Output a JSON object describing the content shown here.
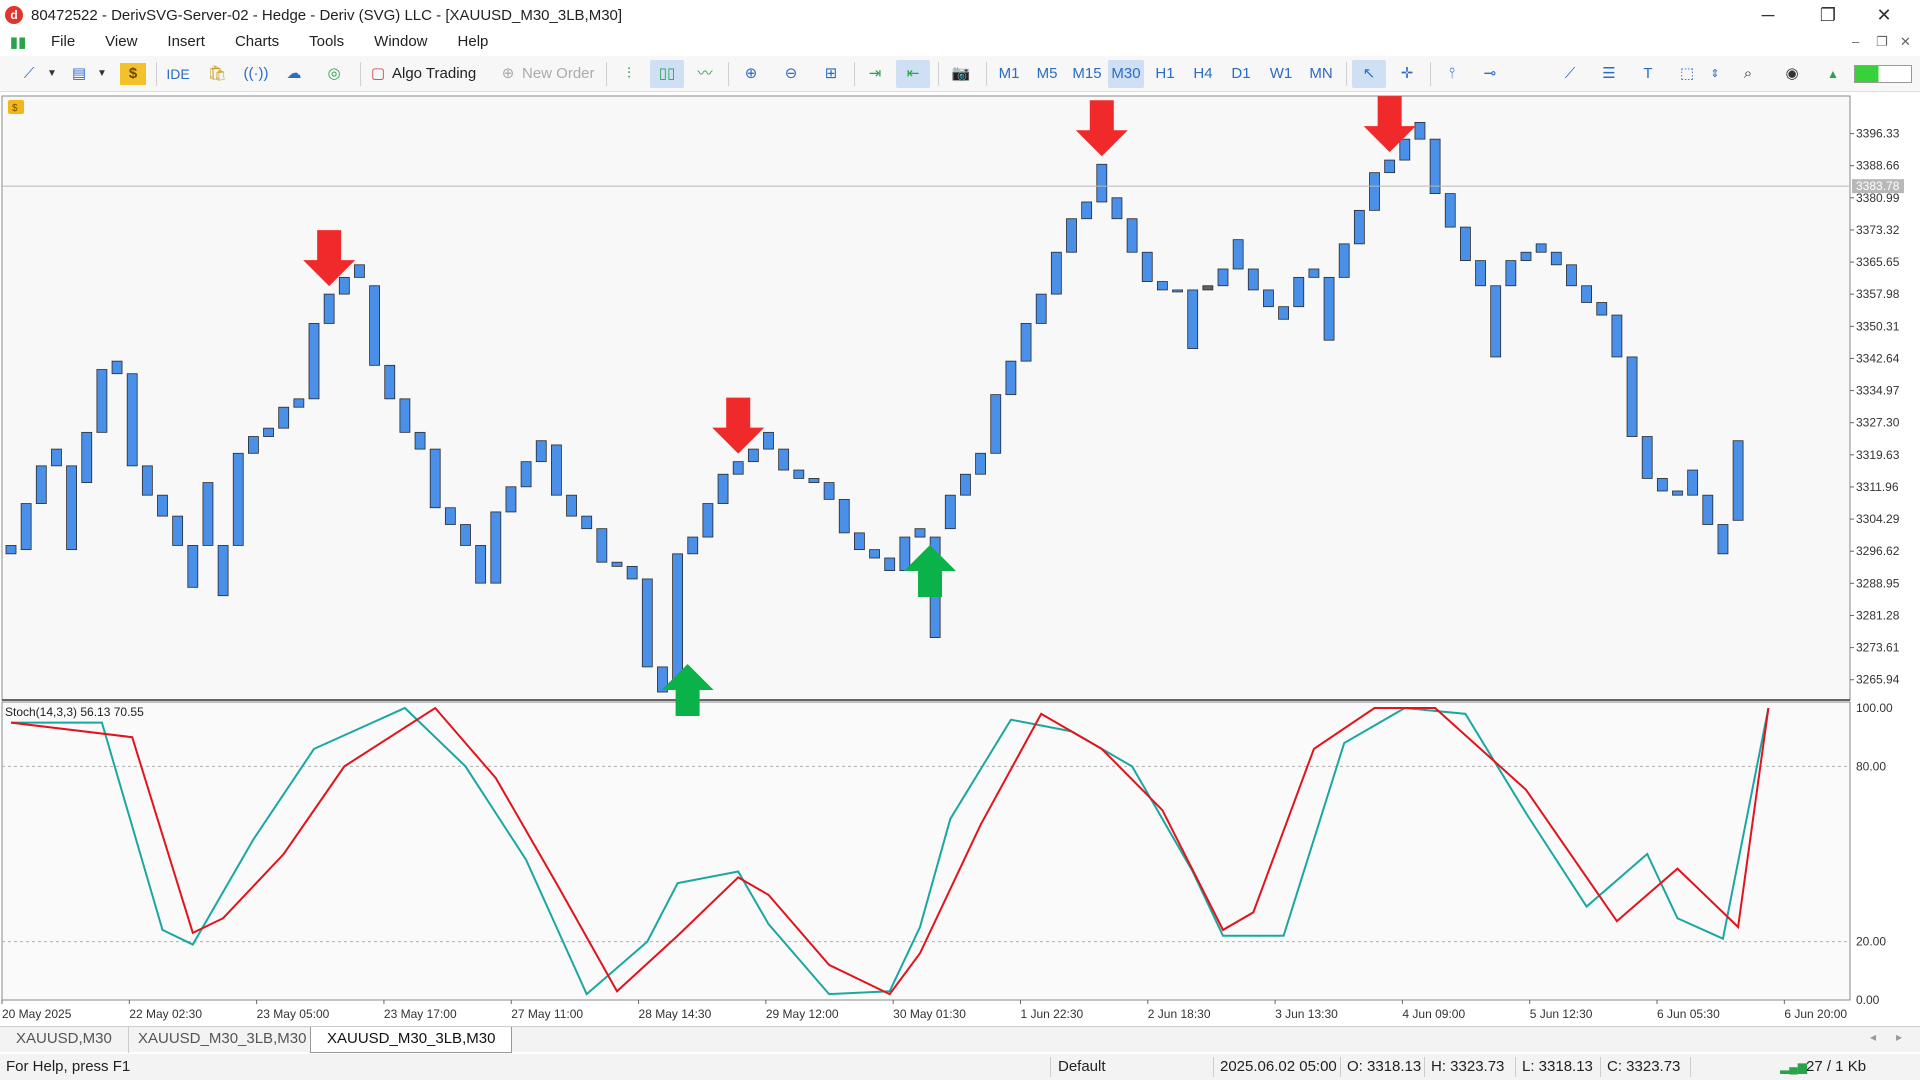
{
  "window": {
    "title": "80472522 - DerivSVG-Server-02 - Hedge - Deriv (SVG) LLC - [XAUUSD_M30_3LB,M30]",
    "minimize": "─",
    "maximize": "❐",
    "close": "✕"
  },
  "menu": {
    "items": [
      "File",
      "View",
      "Insert",
      "Charts",
      "Tools",
      "Window",
      "Help"
    ],
    "mdi": [
      "–",
      "❐",
      "✕"
    ]
  },
  "toolbar": {
    "ide_label": "IDE",
    "algo_label": "Algo Trading",
    "new_order_label": "New Order",
    "timeframes": [
      "M1",
      "M5",
      "M15",
      "M30",
      "H1",
      "H4",
      "D1",
      "W1",
      "MN"
    ],
    "active_timeframe": "M30",
    "accent": "#2b6cc4"
  },
  "chart": {
    "symbol": "XAUUSD_M30_3LB",
    "bull_color": "#4a8fe8",
    "bear_color": "#5f6167",
    "bid_price_label": "3383.78",
    "indicator_label": "Stoch(14,3,3) 56.13 70.55",
    "main_color": "#1aa7a1",
    "signal_color": "#e2131b"
  },
  "chart_data": [
    {
      "type": "candlestick",
      "description": "Line break price chart, XAUUSD M30",
      "y_ticks": [
        "3396.33",
        "3388.66",
        "3380.99",
        "3373.32",
        "3365.65",
        "3357.98",
        "3350.31",
        "3342.64",
        "3334.97",
        "3327.30",
        "3319.63",
        "3311.96",
        "3304.29",
        "3296.62",
        "3288.95",
        "3281.28",
        "3273.61",
        "3265.94"
      ],
      "ylim": [
        3261.1,
        3405.3
      ],
      "x_ticks": [
        "20 May 2025",
        "22 May 02:30",
        "23 May 05:00",
        "23 May 17:00",
        "27 May 11:00",
        "28 May 14:30",
        "29 May 12:00",
        "30 May 01:30",
        "1 Jun 22:30",
        "2 Jun 18:30",
        "3 Jun 13:30",
        "4 Jun 09:00",
        "5 Jun 12:30",
        "6 Jun 05:30",
        "6 Jun 20:00"
      ],
      "bricks": [
        [
          3298,
          3296
        ],
        [
          3308,
          3297
        ],
        [
          3317,
          3308
        ],
        [
          3321,
          3317
        ],
        [
          3317,
          3297
        ],
        [
          3325,
          3313
        ],
        [
          3340,
          3325
        ],
        [
          3342,
          3339
        ],
        [
          3339,
          3317
        ],
        [
          3317,
          3310
        ],
        [
          3310,
          3305
        ],
        [
          3305,
          3298
        ],
        [
          3298,
          3288
        ],
        [
          3313,
          3298
        ],
        [
          3298,
          3286
        ],
        [
          3320,
          3298
        ],
        [
          3324,
          3320
        ],
        [
          3326,
          3324
        ],
        [
          3331,
          3326
        ],
        [
          3333,
          3331
        ],
        [
          3351,
          3333
        ],
        [
          3358,
          3351
        ],
        [
          3362,
          3358
        ],
        [
          3365,
          3362
        ],
        [
          3360,
          3341
        ],
        [
          3341,
          3333
        ],
        [
          3333,
          3325
        ],
        [
          3325,
          3321
        ],
        [
          3321,
          3307
        ],
        [
          3307,
          3303
        ],
        [
          3303,
          3298
        ],
        [
          3298,
          3289
        ],
        [
          3306,
          3289
        ],
        [
          3312,
          3306
        ],
        [
          3318,
          3312
        ],
        [
          3323,
          3318
        ],
        [
          3322,
          3310
        ],
        [
          3310,
          3305
        ],
        [
          3305,
          3302
        ],
        [
          3302,
          3294
        ],
        [
          3294,
          3293
        ],
        [
          3293,
          3290
        ],
        [
          3290,
          3269
        ],
        [
          3269,
          3263
        ],
        [
          3296,
          3265
        ],
        [
          3300,
          3296
        ],
        [
          3308,
          3300
        ],
        [
          3315,
          3308
        ],
        [
          3318,
          3315
        ],
        [
          3321,
          3318
        ],
        [
          3325,
          3321
        ],
        [
          3321,
          3316
        ],
        [
          3316,
          3314
        ],
        [
          3314,
          3313
        ],
        [
          3313,
          3309
        ],
        [
          3309,
          3301
        ],
        [
          3301,
          3297
        ],
        [
          3297,
          3295
        ],
        [
          3295,
          3292
        ],
        [
          3300,
          3292
        ],
        [
          3302,
          3300
        ],
        [
          3300,
          3276
        ],
        [
          3310,
          3302
        ],
        [
          3315,
          3310
        ],
        [
          3320,
          3315
        ],
        [
          3334,
          3320
        ],
        [
          3342,
          3334
        ],
        [
          3351,
          3342
        ],
        [
          3358,
          3351
        ],
        [
          3368,
          3358
        ],
        [
          3376,
          3368
        ],
        [
          3380,
          3376
        ],
        [
          3389,
          3380
        ],
        [
          3381,
          3376
        ],
        [
          3376,
          3368
        ],
        [
          3368,
          3361
        ],
        [
          3361,
          3359
        ],
        [
          3359,
          3359
        ],
        [
          3359,
          3345
        ],
        [
          3359,
          3360
        ],
        [
          3364,
          3360
        ],
        [
          3371,
          3364
        ],
        [
          3364,
          3359
        ],
        [
          3359,
          3355
        ],
        [
          3355,
          3352
        ],
        [
          3362,
          3355
        ],
        [
          3364,
          3362
        ],
        [
          3362,
          3347
        ],
        [
          3370,
          3362
        ],
        [
          3378,
          3370
        ],
        [
          3387,
          3378
        ],
        [
          3390,
          3387
        ],
        [
          3395,
          3390
        ],
        [
          3399,
          3395
        ],
        [
          3395,
          3382
        ],
        [
          3382,
          3374
        ],
        [
          3374,
          3366
        ],
        [
          3366,
          3360
        ],
        [
          3360,
          3343
        ],
        [
          3366,
          3360
        ],
        [
          3368,
          3366
        ],
        [
          3370,
          3368
        ],
        [
          3368,
          3365
        ],
        [
          3365,
          3360
        ],
        [
          3360,
          3356
        ],
        [
          3356,
          3353
        ],
        [
          3353,
          3343
        ],
        [
          3343,
          3324
        ],
        [
          3324,
          3314
        ],
        [
          3314,
          3311
        ],
        [
          3311,
          3310
        ],
        [
          3316,
          3310
        ],
        [
          3310,
          3303
        ],
        [
          3303,
          3296
        ],
        [
          3323,
          3304
        ]
      ],
      "sell_arrows_at_brick": [
        21,
        48,
        72,
        91
      ],
      "buy_arrows_at_brick": [
        44,
        60
      ]
    },
    {
      "type": "line",
      "description": "Stochastic oscillator",
      "ylim": [
        0,
        100
      ],
      "y_ticks": [
        "100.00",
        "80.00",
        "20.00",
        "0.00"
      ],
      "levels": [
        80,
        20
      ],
      "series": [
        {
          "name": "Main",
          "x": [
            0,
            6,
            10,
            12,
            16,
            20,
            26,
            30,
            34,
            38,
            42,
            44,
            48,
            50,
            54,
            58,
            60,
            62,
            66,
            70,
            74,
            78,
            80,
            84,
            88,
            92,
            96,
            100,
            104,
            108,
            110,
            113,
            116
          ],
          "values": [
            95,
            95,
            24,
            19,
            55,
            86,
            100,
            80,
            48,
            2,
            20,
            40,
            44,
            26,
            2,
            3,
            25,
            62,
            96,
            92,
            80,
            44,
            22,
            22,
            88,
            100,
            98,
            64,
            32,
            50,
            28,
            21,
            100
          ]
        },
        {
          "name": "Signal",
          "x": [
            0,
            8,
            12,
            14,
            18,
            22,
            28,
            32,
            36,
            40,
            44,
            48,
            50,
            54,
            58,
            60,
            64,
            68,
            72,
            76,
            80,
            82,
            86,
            90,
            94,
            100,
            106,
            110,
            114,
            116
          ],
          "values": [
            95,
            90,
            23,
            28,
            50,
            80,
            100,
            76,
            40,
            3,
            22,
            42,
            36,
            12,
            2,
            16,
            60,
            98,
            86,
            65,
            24,
            30,
            86,
            100,
            100,
            72,
            27,
            45,
            25,
            100
          ]
        }
      ]
    }
  ],
  "tabs": [
    "XAUUSD,M30",
    "XAUUSD_M30_3LB,M30",
    "XAUUSD_M30_3LB,M30"
  ],
  "active_tab": 2,
  "status": {
    "help": "For Help, press F1",
    "profile": "Default",
    "datetime": "2025.06.02 05:00",
    "open": "O: 3318.13",
    "high": "H: 3323.73",
    "low": "L: 3318.13",
    "close": "C: 3323.73",
    "traffic": "27 / 1 Kb"
  }
}
